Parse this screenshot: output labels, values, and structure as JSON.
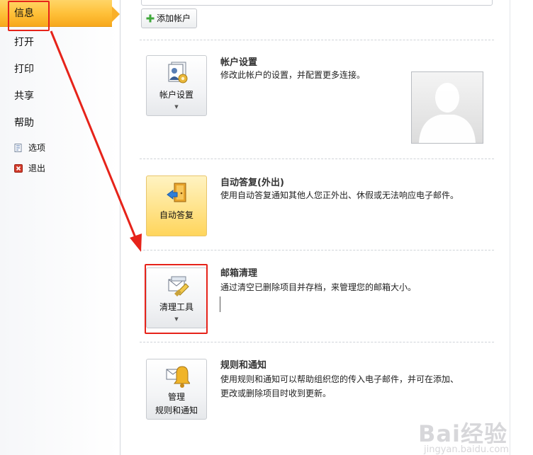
{
  "nav": {
    "items": [
      {
        "label": "信息",
        "active": true
      },
      {
        "label": "打开"
      },
      {
        "label": "打印"
      },
      {
        "label": "共享"
      },
      {
        "label": "帮助"
      }
    ],
    "sub_items": [
      {
        "label": "选项",
        "icon": "options-icon"
      },
      {
        "label": "退出",
        "icon": "exit-icon"
      }
    ]
  },
  "toolbar": {
    "add_account_label": "添加帐户"
  },
  "sections": [
    {
      "title": "帐户设置",
      "description": "修改此帐户的设置，并配置更多连接。",
      "button_label": "帐户设置",
      "icon": "account-settings-icon",
      "has_dropdown": true
    },
    {
      "title": "自动答复(外出)",
      "description": "使用自动答复通知其他人您正外出、休假或无法响应电子邮件。",
      "button_label": "自动答复",
      "icon": "auto-reply-icon",
      "has_dropdown": false
    },
    {
      "title": "邮箱清理",
      "description": "通过清空已删除项目并存档，来管理您的邮箱大小。",
      "button_label": "清理工具",
      "icon": "cleanup-tools-icon",
      "has_dropdown": true
    },
    {
      "title": "规则和通知",
      "description_line1": "使用规则和通知可以帮助组织您的传入电子邮件，并可在添加、",
      "description_line2": "更改或删除项目时收到更新。",
      "button_label_line1": "管理",
      "button_label_line2": "规则和通知",
      "icon": "rules-alerts-icon",
      "has_dropdown": false
    }
  ],
  "caret_glyph": "▼",
  "watermark": {
    "text": "Bai经验",
    "sub": "jingyan.baidu.com"
  },
  "colors": {
    "accent": "#ffc13a",
    "annotation_red": "#e6231a",
    "auto_reply_button": "#ffe38a"
  }
}
